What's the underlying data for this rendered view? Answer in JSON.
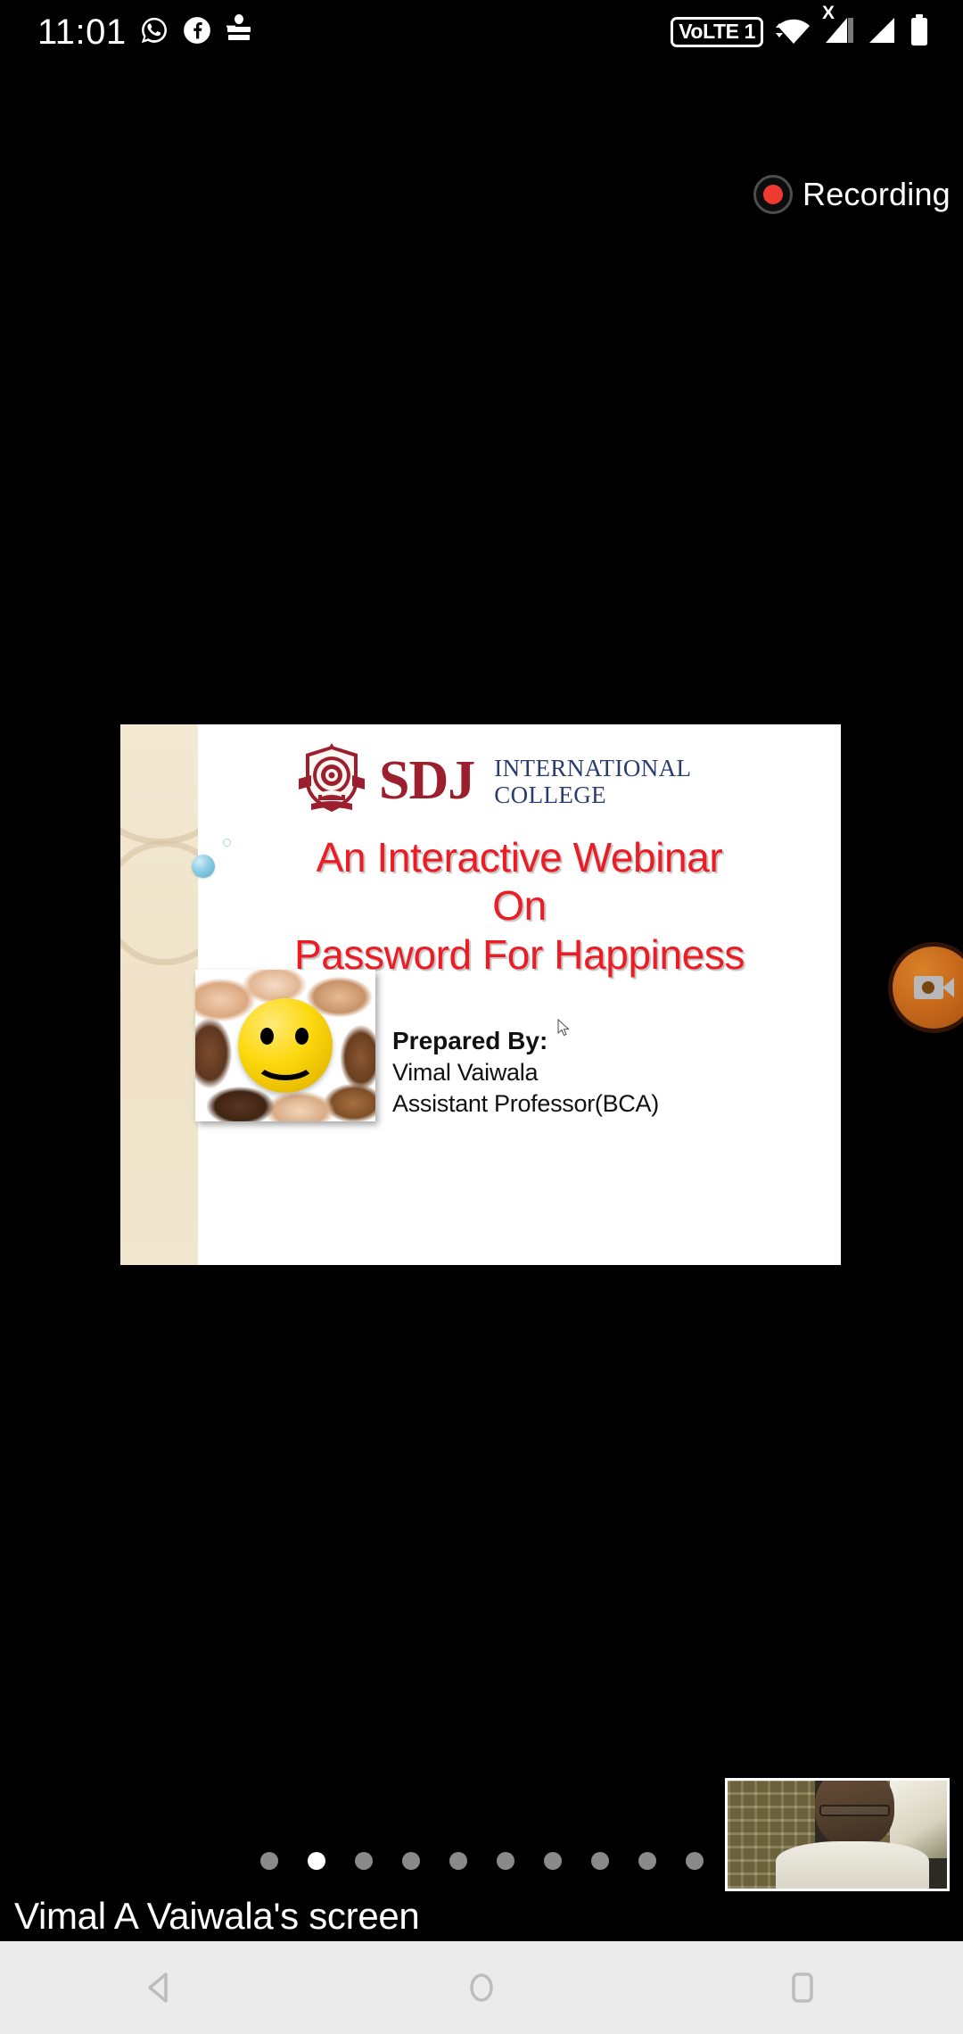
{
  "status_bar": {
    "clock": "11:01",
    "left_icons": [
      {
        "name": "whatsapp-icon",
        "label": "WhatsApp"
      },
      {
        "name": "facebook-icon",
        "label": "Facebook"
      },
      {
        "name": "divya-bhaskar-icon",
        "label": "દિવ્ય ભાસ્કર"
      }
    ],
    "volte_label": "VoLTE 1",
    "right_icons": [
      {
        "name": "wifi-icon",
        "label": "Wi-Fi"
      },
      {
        "name": "signal-no-service-icon",
        "label": "X"
      },
      {
        "name": "signal-icon",
        "label": "Signal"
      },
      {
        "name": "battery-icon",
        "label": "Battery"
      }
    ]
  },
  "recording": {
    "label": "Recording",
    "dot_color": "#ee3b32",
    "ring_color": "#4d4d4d"
  },
  "floating_button": {
    "name": "video-camera-button",
    "accent_color": "#c76a1c"
  },
  "slide": {
    "logo": {
      "abbr": "SDJ",
      "line1": "INTERNATIONAL",
      "line2": "COLLEGE",
      "abbr_color": "#9c1f2e",
      "text_color": "#2a3b6e"
    },
    "title_lines": [
      "An Interactive Webinar",
      "On",
      "Password For Happiness"
    ],
    "title_color": "#ec1c24",
    "prepared_by": {
      "heading": "Prepared By:",
      "name": "Vimal Vaiwala",
      "designation": "Assistant Professor(BCA)"
    },
    "image_alt": "smiley-ball-held-by-hands"
  },
  "pager": {
    "total": 10,
    "active_index": 1
  },
  "screen_share": {
    "label": "Vimal A Vaiwala's screen"
  },
  "video_thumbnail": {
    "name": "self-view-thumbnail"
  },
  "nav_bar": {
    "buttons": [
      {
        "name": "back-button",
        "label": "Back"
      },
      {
        "name": "home-button",
        "label": "Home"
      },
      {
        "name": "recents-button",
        "label": "Recents"
      }
    ]
  }
}
